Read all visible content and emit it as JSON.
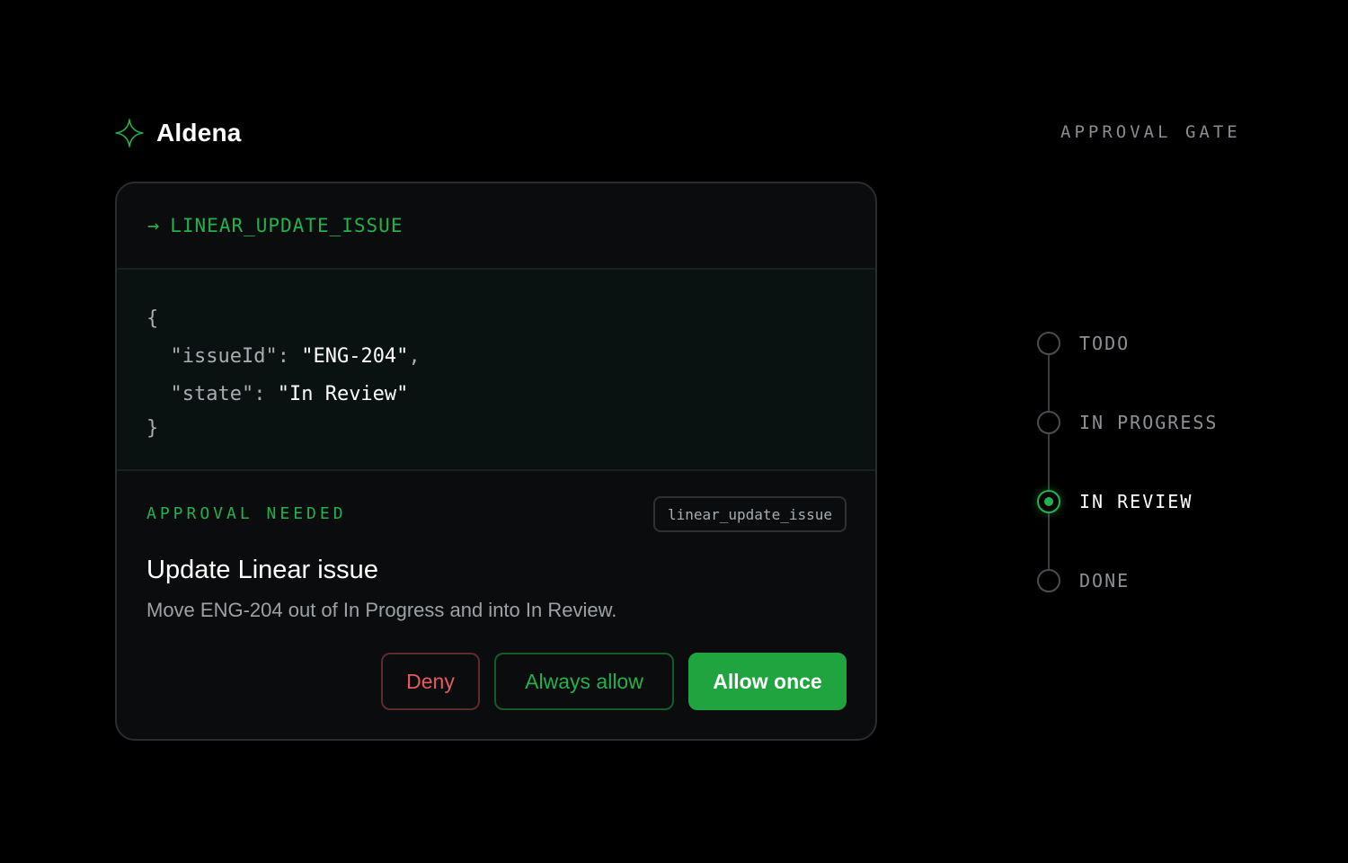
{
  "brand": {
    "name": "Aldena",
    "icon": "sparkle-icon",
    "accent": "#22b14c"
  },
  "header": {
    "gate_label": "APPROVAL GATE"
  },
  "tool_call": {
    "arrow": "→",
    "name": "LINEAR_UPDATE_ISSUE",
    "args": {
      "open_brace": "{",
      "lines": [
        {
          "key": "\"issueId\"",
          "value": "\"ENG-204\"",
          "trailing": ","
        },
        {
          "key": "\"state\"",
          "value": "\"In Review\"",
          "trailing": ""
        }
      ],
      "close_brace": "}"
    }
  },
  "approval": {
    "label": "APPROVAL NEEDED",
    "tool_tag": "linear_update_issue",
    "title": "Update Linear issue",
    "description": "Move ENG-204 out of In Progress and into In Review.",
    "buttons": {
      "deny": "Deny",
      "always_allow": "Always allow",
      "allow_once": "Allow once"
    }
  },
  "timeline": {
    "stages": [
      {
        "label": "TODO",
        "active": false
      },
      {
        "label": "IN PROGRESS",
        "active": false
      },
      {
        "label": "IN REVIEW",
        "active": true
      },
      {
        "label": "DONE",
        "active": false
      }
    ]
  },
  "colors": {
    "background": "#000000",
    "card": "#0b0c0d",
    "green": "#22b14c",
    "button_green": "#1fa43f",
    "red": "#e55a5f"
  }
}
